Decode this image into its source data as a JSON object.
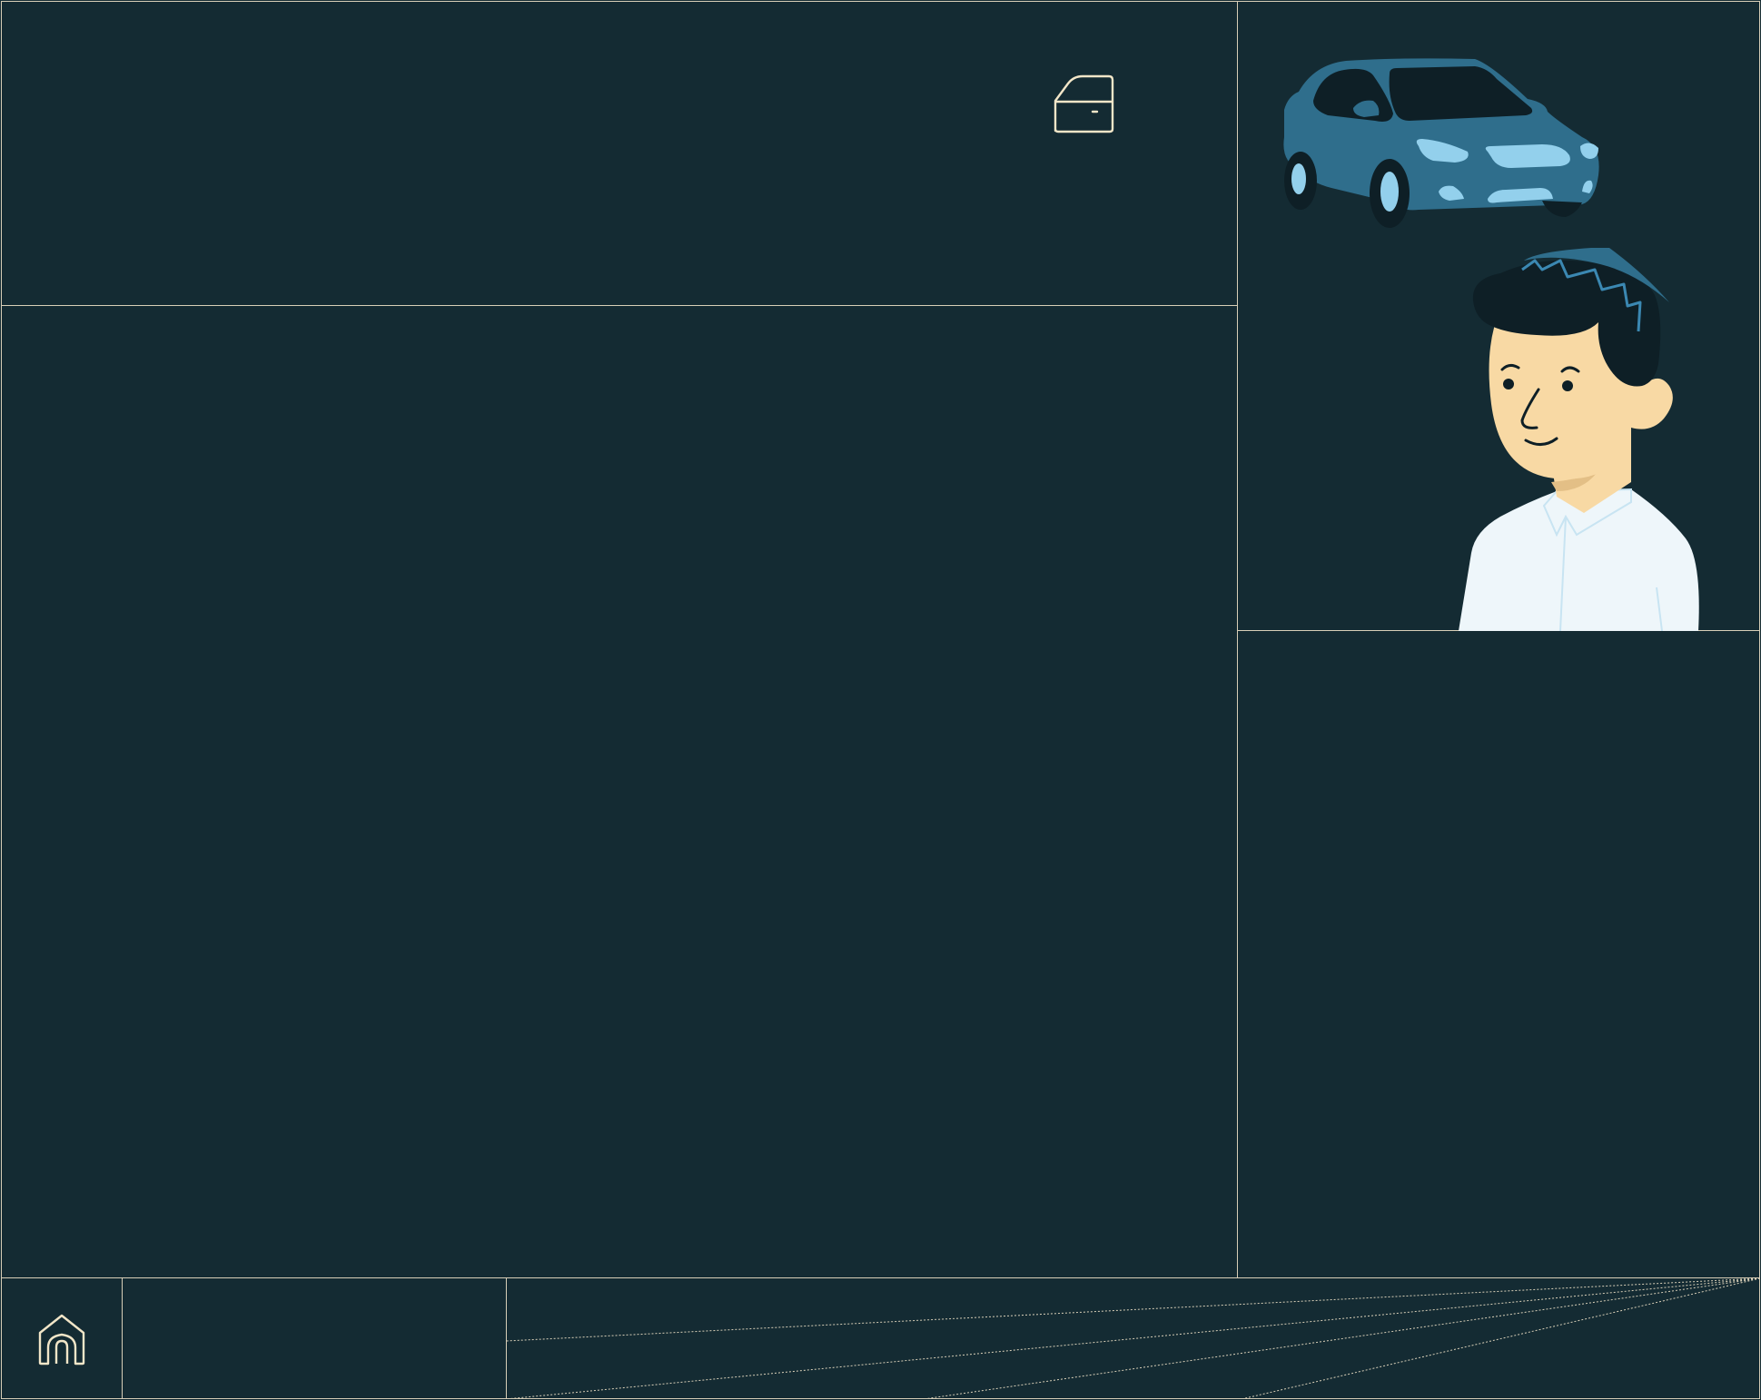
{
  "icons": {
    "door": "car-door-icon",
    "home": "home-icon"
  },
  "illustration": {
    "subjects": [
      "car",
      "person"
    ]
  },
  "colors": {
    "background": "#142b33",
    "border": "#d8cfb8",
    "icon_stroke": "#f2e6c8",
    "car_body": "#2f6e8c",
    "car_highlight": "#93d0ec",
    "skin": "#f8d9a4",
    "hair": "#0e1f26",
    "shirt": "#eef6fa"
  }
}
